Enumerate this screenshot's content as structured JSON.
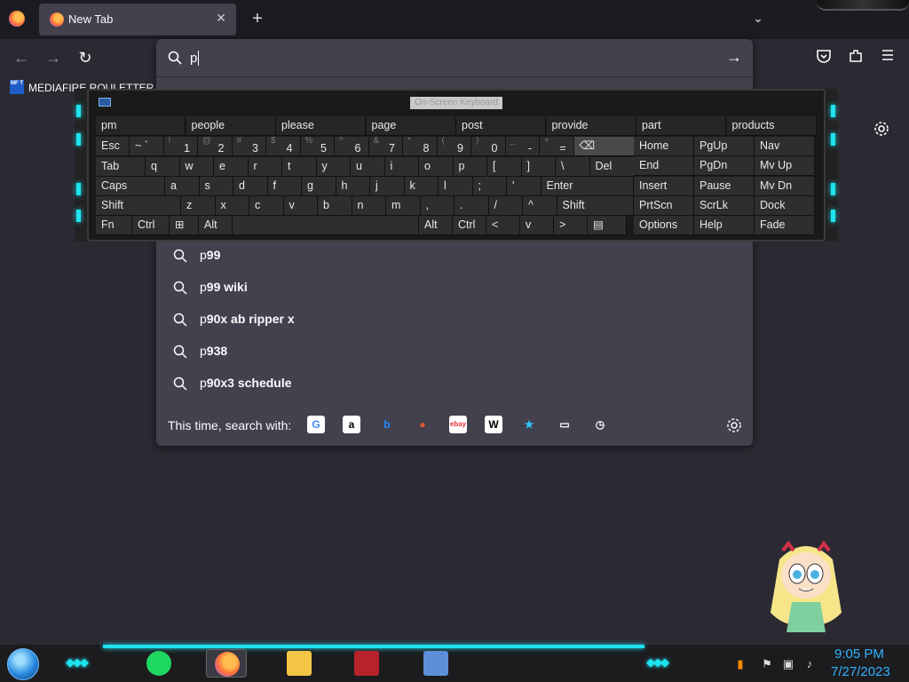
{
  "browser": {
    "tab_title": "New Tab",
    "close_glyph": "✕",
    "new_tab_glyph": "+",
    "tab_list_glyph": "⌄",
    "back_glyph": "←",
    "forward_glyph": "→",
    "reload_glyph": "↻",
    "go_glyph": "→",
    "bookmark": {
      "icon_text": "MF T",
      "label": "MEDIAFIRE ROULETTER"
    },
    "toolbar_icons": [
      "pocket-icon",
      "extensions-icon",
      "menu-icon"
    ]
  },
  "urlbar": {
    "value": "p",
    "suggestions": [
      {
        "prefix": "p",
        "rest": "99"
      },
      {
        "prefix": "p",
        "rest": "99 wiki"
      },
      {
        "prefix": "p",
        "rest": "90x ab ripper x"
      },
      {
        "prefix": "p",
        "rest": "938"
      },
      {
        "prefix": "p",
        "rest": "90x3 schedule"
      }
    ],
    "search_with_label": "This time, search with:",
    "engines": [
      {
        "name": "google",
        "glyph": "G",
        "color": "#4285f4",
        "bg": "#ffffff"
      },
      {
        "name": "amazon",
        "glyph": "a",
        "color": "#000000",
        "bg": "#ffffff"
      },
      {
        "name": "bing",
        "glyph": "b",
        "color": "#1a8cff",
        "bg": "transparent"
      },
      {
        "name": "duckduckgo",
        "glyph": "●",
        "color": "#de5833",
        "bg": "transparent"
      },
      {
        "name": "ebay",
        "glyph": "ebay",
        "color": "#e53238",
        "bg": "#ffffff"
      },
      {
        "name": "wikipedia",
        "glyph": "W",
        "color": "#000000",
        "bg": "#ffffff"
      },
      {
        "name": "bookmarks",
        "glyph": "★",
        "color": "#2fc4ff",
        "bg": "transparent"
      },
      {
        "name": "tabs",
        "glyph": "▭",
        "color": "#fbfbfe",
        "bg": "transparent"
      },
      {
        "name": "history",
        "glyph": "◷",
        "color": "#fbfbfe",
        "bg": "transparent"
      }
    ]
  },
  "keyboard": {
    "title": "On-Screen Keyboard",
    "predictions": [
      "pm",
      "people",
      "please",
      "page",
      "post",
      "provide",
      "part",
      "products"
    ],
    "row1": [
      [
        "Esc",
        ""
      ],
      [
        "~ `",
        ""
      ],
      [
        "1",
        "!"
      ],
      [
        "2",
        "@"
      ],
      [
        "3",
        "#"
      ],
      [
        "4",
        "$"
      ],
      [
        "5",
        "%"
      ],
      [
        "6",
        "^"
      ],
      [
        "7",
        "&"
      ],
      [
        "8",
        "*"
      ],
      [
        "9",
        "("
      ],
      [
        "0",
        ")"
      ],
      [
        "-",
        "_"
      ],
      [
        "=",
        "+"
      ],
      [
        "⌫",
        ""
      ]
    ],
    "row2": [
      "Tab",
      "q",
      "w",
      "e",
      "r",
      "t",
      "y",
      "u",
      "i",
      "o",
      "p",
      "[",
      "]",
      "\\",
      "Del"
    ],
    "row3": [
      "Caps",
      "a",
      "s",
      "d",
      "f",
      "g",
      "h",
      "j",
      "k",
      "l",
      ";",
      "'",
      "Enter"
    ],
    "row4": [
      "Shift",
      "z",
      "x",
      "c",
      "v",
      "b",
      "n",
      "m",
      ",",
      ".",
      "/",
      "^",
      "Shift"
    ],
    "row5": [
      "Fn",
      "Ctrl",
      "⊞",
      "Alt",
      "",
      "Alt",
      "Ctrl",
      "<",
      "v",
      ">",
      "▤"
    ],
    "nav": [
      [
        "Home",
        "PgUp",
        "Nav"
      ],
      [
        "End",
        "PgDn",
        "Mv Up"
      ],
      [
        "Insert",
        "Pause",
        "Mv Dn"
      ],
      [
        "PrtScn",
        "ScrLk",
        "Dock"
      ],
      [
        "Options",
        "Help",
        "Fade"
      ]
    ]
  },
  "taskbar": {
    "time": "9:05 PM",
    "date": "7/27/2023",
    "apps": [
      "spotify",
      "firefox",
      "file-explorer",
      "media-app",
      "remote-desktop"
    ]
  },
  "colors": {
    "accent_cyan": "#1ee3f0",
    "clock_blue": "#2fb3ff",
    "popup_bg": "#42414d",
    "page_bg": "#2b2a33"
  }
}
